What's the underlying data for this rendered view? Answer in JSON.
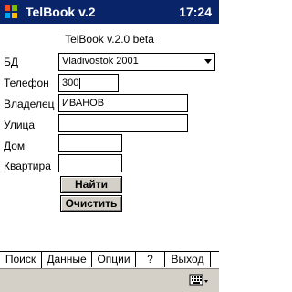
{
  "titlebar": {
    "title": "TelBook v.2",
    "clock": "17:24"
  },
  "form": {
    "heading": "TelBook v.2.0 beta",
    "db": {
      "label": "БД",
      "value": "Vladivostok 2001"
    },
    "phone": {
      "label": "Телефон",
      "value": "300"
    },
    "owner": {
      "label": "Владелец",
      "value": "ИВАНОВ"
    },
    "street": {
      "label": "Улица",
      "value": ""
    },
    "house": {
      "label": "Дом",
      "value": ""
    },
    "apartment": {
      "label": "Квартира",
      "value": ""
    }
  },
  "buttons": {
    "find": "Найти",
    "clear": "Очистить"
  },
  "tabs": [
    {
      "label": "Поиск",
      "active": true
    },
    {
      "label": "Данные",
      "active": false
    },
    {
      "label": "Опции",
      "active": false
    },
    {
      "label": "?",
      "active": false
    },
    {
      "label": "Выход",
      "active": false
    }
  ],
  "icons": {
    "window": "windows-flag-icon",
    "dropdown": "dropdown-arrow-icon",
    "sip": "keyboard-icon"
  },
  "colors": {
    "titlebar": "#0a246a",
    "button_face": "#d4d0c8"
  }
}
